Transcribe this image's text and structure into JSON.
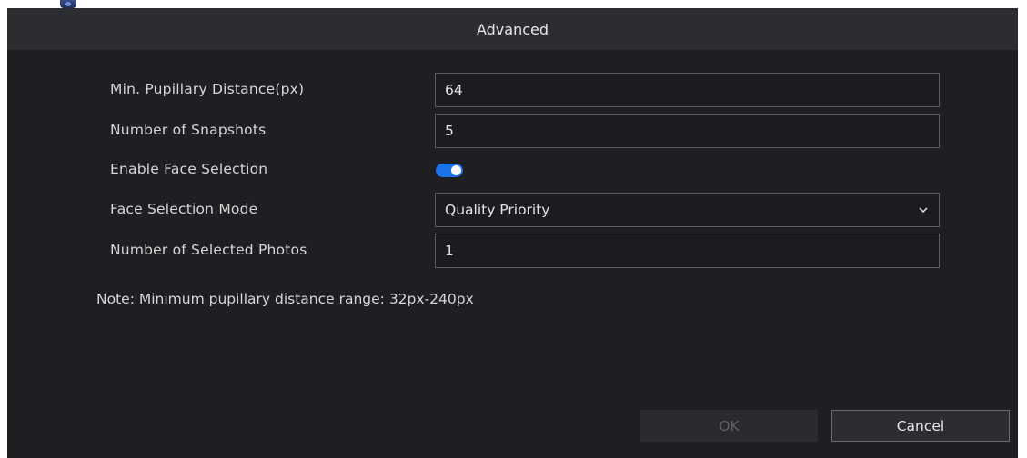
{
  "dialog": {
    "title": "Advanced"
  },
  "form": {
    "min_pupillary_distance": {
      "label": "Min. Pupillary Distance(px)",
      "value": "64"
    },
    "number_of_snapshots": {
      "label": "Number of Snapshots",
      "value": "5"
    },
    "enable_face_selection": {
      "label": "Enable Face Selection",
      "enabled": true
    },
    "face_selection_mode": {
      "label": "Face Selection Mode",
      "value": "Quality Priority"
    },
    "number_of_selected_photos": {
      "label": "Number of Selected Photos",
      "value": "1"
    }
  },
  "note": "Note: Minimum pupillary distance range: 32px-240px",
  "buttons": {
    "ok": "OK",
    "cancel": "Cancel"
  },
  "colors": {
    "toggle_on": "#1a73e8",
    "dialog_bg": "#1e1f22",
    "header_bg": "#2c2d31"
  }
}
